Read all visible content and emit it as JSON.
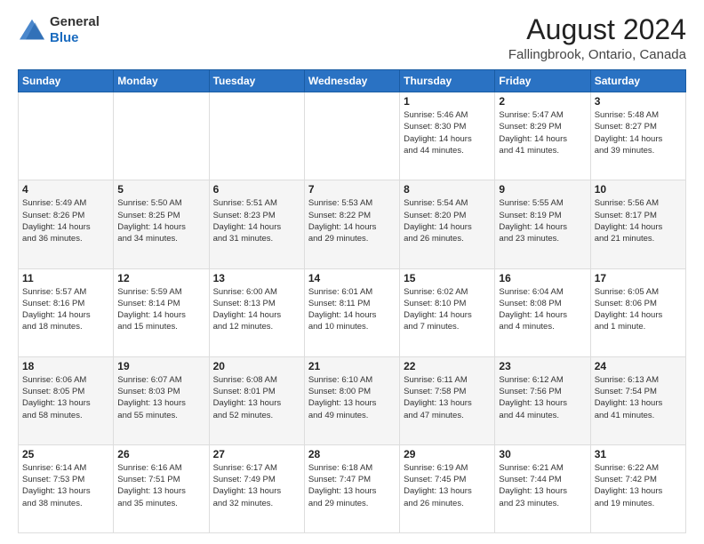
{
  "header": {
    "logo_line1": "General",
    "logo_line2": "Blue",
    "title": "August 2024",
    "subtitle": "Fallingbrook, Ontario, Canada"
  },
  "weekdays": [
    "Sunday",
    "Monday",
    "Tuesday",
    "Wednesday",
    "Thursday",
    "Friday",
    "Saturday"
  ],
  "weeks": [
    [
      {
        "day": "",
        "info": ""
      },
      {
        "day": "",
        "info": ""
      },
      {
        "day": "",
        "info": ""
      },
      {
        "day": "",
        "info": ""
      },
      {
        "day": "1",
        "info": "Sunrise: 5:46 AM\nSunset: 8:30 PM\nDaylight: 14 hours\nand 44 minutes."
      },
      {
        "day": "2",
        "info": "Sunrise: 5:47 AM\nSunset: 8:29 PM\nDaylight: 14 hours\nand 41 minutes."
      },
      {
        "day": "3",
        "info": "Sunrise: 5:48 AM\nSunset: 8:27 PM\nDaylight: 14 hours\nand 39 minutes."
      }
    ],
    [
      {
        "day": "4",
        "info": "Sunrise: 5:49 AM\nSunset: 8:26 PM\nDaylight: 14 hours\nand 36 minutes."
      },
      {
        "day": "5",
        "info": "Sunrise: 5:50 AM\nSunset: 8:25 PM\nDaylight: 14 hours\nand 34 minutes."
      },
      {
        "day": "6",
        "info": "Sunrise: 5:51 AM\nSunset: 8:23 PM\nDaylight: 14 hours\nand 31 minutes."
      },
      {
        "day": "7",
        "info": "Sunrise: 5:53 AM\nSunset: 8:22 PM\nDaylight: 14 hours\nand 29 minutes."
      },
      {
        "day": "8",
        "info": "Sunrise: 5:54 AM\nSunset: 8:20 PM\nDaylight: 14 hours\nand 26 minutes."
      },
      {
        "day": "9",
        "info": "Sunrise: 5:55 AM\nSunset: 8:19 PM\nDaylight: 14 hours\nand 23 minutes."
      },
      {
        "day": "10",
        "info": "Sunrise: 5:56 AM\nSunset: 8:17 PM\nDaylight: 14 hours\nand 21 minutes."
      }
    ],
    [
      {
        "day": "11",
        "info": "Sunrise: 5:57 AM\nSunset: 8:16 PM\nDaylight: 14 hours\nand 18 minutes."
      },
      {
        "day": "12",
        "info": "Sunrise: 5:59 AM\nSunset: 8:14 PM\nDaylight: 14 hours\nand 15 minutes."
      },
      {
        "day": "13",
        "info": "Sunrise: 6:00 AM\nSunset: 8:13 PM\nDaylight: 14 hours\nand 12 minutes."
      },
      {
        "day": "14",
        "info": "Sunrise: 6:01 AM\nSunset: 8:11 PM\nDaylight: 14 hours\nand 10 minutes."
      },
      {
        "day": "15",
        "info": "Sunrise: 6:02 AM\nSunset: 8:10 PM\nDaylight: 14 hours\nand 7 minutes."
      },
      {
        "day": "16",
        "info": "Sunrise: 6:04 AM\nSunset: 8:08 PM\nDaylight: 14 hours\nand 4 minutes."
      },
      {
        "day": "17",
        "info": "Sunrise: 6:05 AM\nSunset: 8:06 PM\nDaylight: 14 hours\nand 1 minute."
      }
    ],
    [
      {
        "day": "18",
        "info": "Sunrise: 6:06 AM\nSunset: 8:05 PM\nDaylight: 13 hours\nand 58 minutes."
      },
      {
        "day": "19",
        "info": "Sunrise: 6:07 AM\nSunset: 8:03 PM\nDaylight: 13 hours\nand 55 minutes."
      },
      {
        "day": "20",
        "info": "Sunrise: 6:08 AM\nSunset: 8:01 PM\nDaylight: 13 hours\nand 52 minutes."
      },
      {
        "day": "21",
        "info": "Sunrise: 6:10 AM\nSunset: 8:00 PM\nDaylight: 13 hours\nand 49 minutes."
      },
      {
        "day": "22",
        "info": "Sunrise: 6:11 AM\nSunset: 7:58 PM\nDaylight: 13 hours\nand 47 minutes."
      },
      {
        "day": "23",
        "info": "Sunrise: 6:12 AM\nSunset: 7:56 PM\nDaylight: 13 hours\nand 44 minutes."
      },
      {
        "day": "24",
        "info": "Sunrise: 6:13 AM\nSunset: 7:54 PM\nDaylight: 13 hours\nand 41 minutes."
      }
    ],
    [
      {
        "day": "25",
        "info": "Sunrise: 6:14 AM\nSunset: 7:53 PM\nDaylight: 13 hours\nand 38 minutes."
      },
      {
        "day": "26",
        "info": "Sunrise: 6:16 AM\nSunset: 7:51 PM\nDaylight: 13 hours\nand 35 minutes."
      },
      {
        "day": "27",
        "info": "Sunrise: 6:17 AM\nSunset: 7:49 PM\nDaylight: 13 hours\nand 32 minutes."
      },
      {
        "day": "28",
        "info": "Sunrise: 6:18 AM\nSunset: 7:47 PM\nDaylight: 13 hours\nand 29 minutes."
      },
      {
        "day": "29",
        "info": "Sunrise: 6:19 AM\nSunset: 7:45 PM\nDaylight: 13 hours\nand 26 minutes."
      },
      {
        "day": "30",
        "info": "Sunrise: 6:21 AM\nSunset: 7:44 PM\nDaylight: 13 hours\nand 23 minutes."
      },
      {
        "day": "31",
        "info": "Sunrise: 6:22 AM\nSunset: 7:42 PM\nDaylight: 13 hours\nand 19 minutes."
      }
    ]
  ]
}
